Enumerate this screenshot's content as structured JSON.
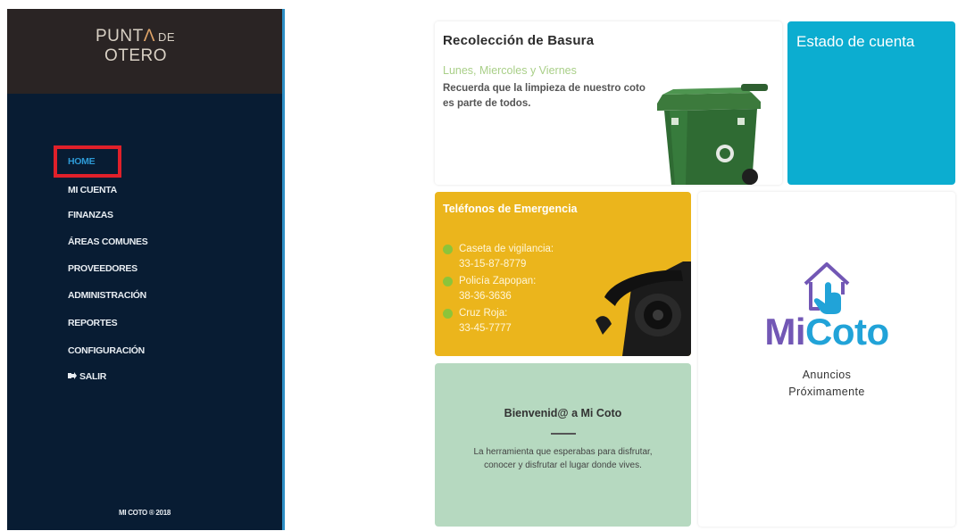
{
  "brand": {
    "line1_part1": "PUNT",
    "line1_accent": "Λ",
    "line1_de": "DE",
    "line2": "OTERO"
  },
  "sidebar": {
    "items": [
      {
        "label": "HOME",
        "active": true
      },
      {
        "label": "MI CUENTA"
      },
      {
        "label": "FINANZAS"
      },
      {
        "label": "ÁREAS COMUNES"
      },
      {
        "label": "PROVEEDORES"
      },
      {
        "label": "ADMINISTRACIÓN"
      },
      {
        "label": "REPORTES"
      },
      {
        "label": "CONFIGURACIÓN"
      },
      {
        "label": "SALIR",
        "icon": "logout-icon"
      }
    ],
    "footer": "MI COTO ® 2018"
  },
  "cards": {
    "basura": {
      "title": "Recolección de Basura",
      "days": "Lunes, Miercoles y Viernes",
      "message": "Recuerda que la limpieza de nuestro coto es parte de todos.",
      "image": "trash-bin-image"
    },
    "cuenta": {
      "title": "Estado de cuenta"
    },
    "telefonos": {
      "title": "Teléfonos de Emergencia",
      "contacts": [
        {
          "name": "Caseta de vigilancia:",
          "number": "33-15-87-8779"
        },
        {
          "name": "Policía Zapopan:",
          "number": "38-36-3636"
        },
        {
          "name": "Cruz Roja:",
          "number": "33-45-7777"
        }
      ],
      "image": "telephone-image"
    },
    "bienvenida": {
      "title": "Bienvenid@ a Mi Coto",
      "text": "La herramienta que esperabas para disfrutar, conocer y disfrutar el lugar donde vives."
    },
    "micoto": {
      "logo_mi": "Mi",
      "logo_coto": "Coto",
      "line1": "Anuncios",
      "line2": "Próximamente",
      "icon": "house-touch-icon"
    }
  },
  "colors": {
    "sidebar_bg": "#081c33",
    "brand_bg": "#2a2424",
    "active_nav": "#2d9ad6",
    "highlight_box": "#e0202a",
    "cuenta_bg": "#0cadd0",
    "telefonos_bg": "#ebb51c",
    "bienvenida_bg": "#b6d9c0",
    "logo_purple": "#7257b5",
    "logo_blue": "#21a3d8"
  }
}
